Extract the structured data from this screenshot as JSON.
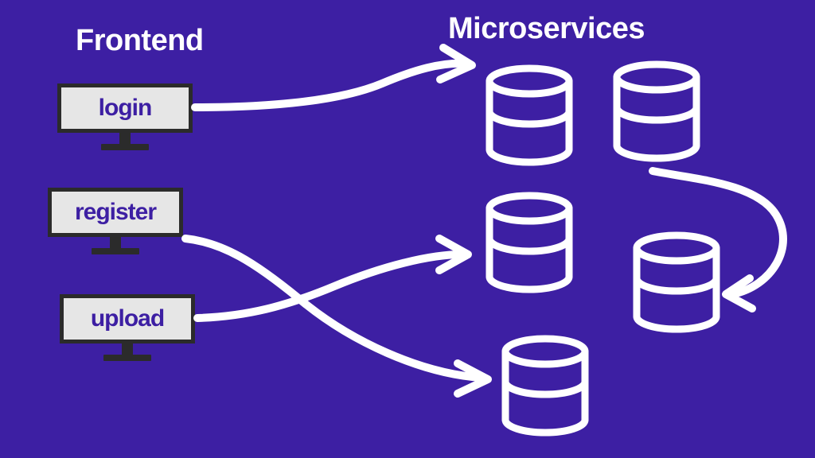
{
  "headings": {
    "frontend": "Frontend",
    "microservices": "Microservices"
  },
  "monitors": {
    "login": "login",
    "register": "register",
    "upload": "upload"
  },
  "diagram": {
    "nodes": {
      "frontend": [
        "login",
        "register",
        "upload"
      ],
      "microservices": [
        "db-top-left",
        "db-top-right",
        "db-mid-left",
        "db-mid-right",
        "db-bottom"
      ]
    },
    "edges": [
      {
        "from": "login",
        "to": "db-top-left"
      },
      {
        "from": "register",
        "to": "db-bottom"
      },
      {
        "from": "upload",
        "to": "db-mid-left"
      },
      {
        "from": "db-top-right",
        "to": "db-mid-right"
      }
    ]
  },
  "colors": {
    "background": "#3d1fa3",
    "stroke": "#ffffff",
    "monitor_frame": "#2b2b2b",
    "monitor_screen": "#e6e6e6"
  }
}
